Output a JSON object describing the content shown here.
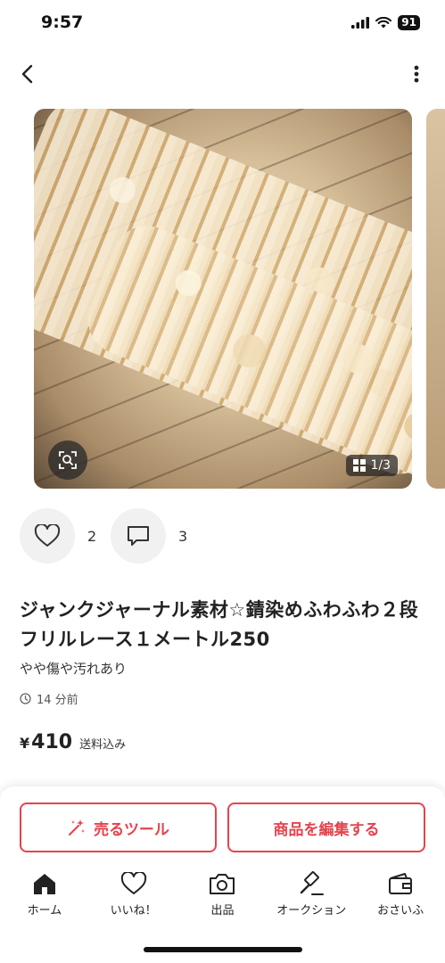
{
  "status_bar": {
    "time": "9:57",
    "battery": "91"
  },
  "header": {
    "back_icon": "chevron-left-icon",
    "more_icon": "vertical-ellipsis-icon"
  },
  "carousel": {
    "page_indicator": "1/3",
    "lens_icon": "image-search-icon",
    "grid_icon": "grid-icon"
  },
  "actions": {
    "likes": "2",
    "comments": "3"
  },
  "item": {
    "title": "ジャンクジャーナル素材☆錆染めふわふわ２段フリルレース１メートル250",
    "condition": "やや傷や汚れあり",
    "posted": "14 分前",
    "price_symbol": "¥",
    "price": "410",
    "shipping": "送料込み"
  },
  "buttons": {
    "sell_tool": "売るツール",
    "edit": "商品を編集する"
  },
  "tabs": [
    {
      "label": "ホーム",
      "icon": "home-icon"
    },
    {
      "label": "いいね！",
      "icon": "heart-icon"
    },
    {
      "label": "出品",
      "icon": "camera-icon"
    },
    {
      "label": "オークション",
      "icon": "gavel-icon"
    },
    {
      "label": "おさいふ",
      "icon": "wallet-icon"
    }
  ],
  "colors": {
    "accent": "#e5434d",
    "text": "#222222",
    "chip_bg": "#f1f1f1"
  }
}
